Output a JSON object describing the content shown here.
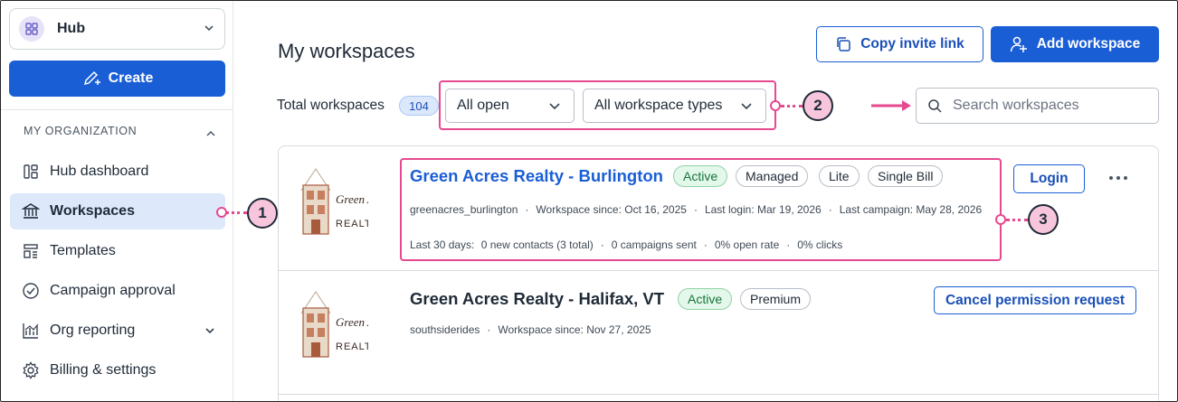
{
  "sidebar": {
    "hub_label": "Hub",
    "create_label": "Create",
    "section_header": "MY ORGANIZATION",
    "items": [
      {
        "label": "Hub dashboard"
      },
      {
        "label": "Workspaces"
      },
      {
        "label": "Templates"
      },
      {
        "label": "Campaign approval"
      },
      {
        "label": "Org reporting"
      },
      {
        "label": "Billing & settings"
      }
    ]
  },
  "header": {
    "title": "My workspaces",
    "copy_invite_label": "Copy invite link",
    "add_workspace_label": "Add workspace"
  },
  "filters": {
    "total_label": "Total workspaces",
    "total_count": "104",
    "status_selected": "All open",
    "type_selected": "All workspace types",
    "search_placeholder": "Search workspaces"
  },
  "callouts": {
    "one": "1",
    "two": "2",
    "three": "3"
  },
  "workspaces": [
    {
      "name": "Green Acres Realty - Burlington",
      "badges": [
        "Active",
        "Managed",
        "Lite",
        "Single Bill"
      ],
      "username": "greenacres_burlington",
      "since": "Workspace since: Oct 16, 2025",
      "last_login": "Last login: Mar 19, 2026",
      "last_campaign": "Last campaign: May 28, 2026",
      "stats_label": "Last 30 days:",
      "new_contacts": "0 new contacts (3 total)",
      "campaigns_sent": "0 campaigns sent",
      "open_rate": "0% open rate",
      "clicks": "0% clicks",
      "action_label": "Login",
      "logo_text_top": "Green Acres",
      "logo_text_bottom": "REALTY"
    },
    {
      "name": "Green Acres Realty - Halifax, VT",
      "badges": [
        "Active",
        "Premium"
      ],
      "username": "southsiderides",
      "since": "Workspace since: Nov 27, 2025",
      "action_label": "Cancel permission request",
      "logo_text_top": "Green Acres",
      "logo_text_bottom": "REALTY"
    }
  ],
  "colors": {
    "primary": "#1a5ed6",
    "callout": "#e6498f",
    "marker_fill": "#f7c6dc",
    "active_badge_bg": "#e3f7ea",
    "active_badge_text": "#16743a",
    "nav_active_bg": "#dde9fb"
  },
  "icons": {
    "hub": "grid-icon",
    "create": "pen-plus-icon",
    "hub_dashboard": "dashboard-icon",
    "workspaces": "bank-icon",
    "templates": "template-icon",
    "campaign_approval": "check-circle-icon",
    "org_reporting": "chart-icon",
    "billing": "gear-icon",
    "copy": "copy-icon",
    "add_user": "add-user-icon",
    "search": "search-icon",
    "more": "more-horizontal-icon"
  }
}
